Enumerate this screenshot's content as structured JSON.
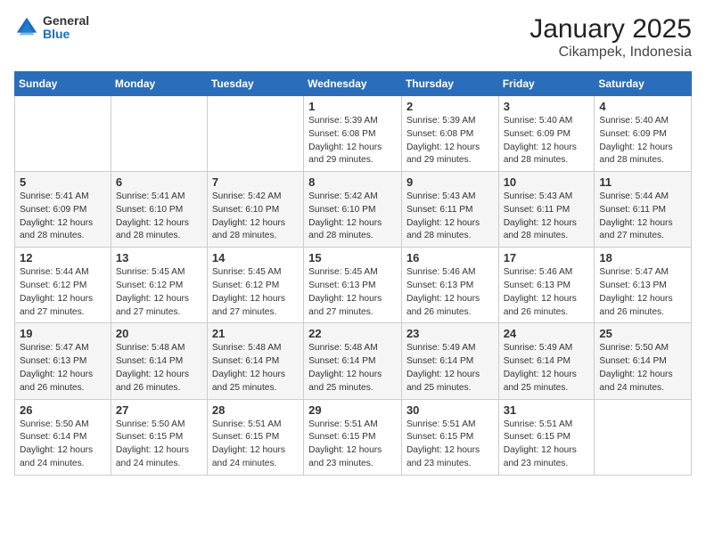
{
  "logo": {
    "line1": "General",
    "line2": "Blue"
  },
  "title": "January 2025",
  "subtitle": "Cikampek, Indonesia",
  "days_header": [
    "Sunday",
    "Monday",
    "Tuesday",
    "Wednesday",
    "Thursday",
    "Friday",
    "Saturday"
  ],
  "weeks": [
    [
      {
        "day": "",
        "sunrise": "",
        "sunset": "",
        "daylight": ""
      },
      {
        "day": "",
        "sunrise": "",
        "sunset": "",
        "daylight": ""
      },
      {
        "day": "",
        "sunrise": "",
        "sunset": "",
        "daylight": ""
      },
      {
        "day": "1",
        "sunrise": "Sunrise: 5:39 AM",
        "sunset": "Sunset: 6:08 PM",
        "daylight": "Daylight: 12 hours and 29 minutes."
      },
      {
        "day": "2",
        "sunrise": "Sunrise: 5:39 AM",
        "sunset": "Sunset: 6:08 PM",
        "daylight": "Daylight: 12 hours and 29 minutes."
      },
      {
        "day": "3",
        "sunrise": "Sunrise: 5:40 AM",
        "sunset": "Sunset: 6:09 PM",
        "daylight": "Daylight: 12 hours and 28 minutes."
      },
      {
        "day": "4",
        "sunrise": "Sunrise: 5:40 AM",
        "sunset": "Sunset: 6:09 PM",
        "daylight": "Daylight: 12 hours and 28 minutes."
      }
    ],
    [
      {
        "day": "5",
        "sunrise": "Sunrise: 5:41 AM",
        "sunset": "Sunset: 6:09 PM",
        "daylight": "Daylight: 12 hours and 28 minutes."
      },
      {
        "day": "6",
        "sunrise": "Sunrise: 5:41 AM",
        "sunset": "Sunset: 6:10 PM",
        "daylight": "Daylight: 12 hours and 28 minutes."
      },
      {
        "day": "7",
        "sunrise": "Sunrise: 5:42 AM",
        "sunset": "Sunset: 6:10 PM",
        "daylight": "Daylight: 12 hours and 28 minutes."
      },
      {
        "day": "8",
        "sunrise": "Sunrise: 5:42 AM",
        "sunset": "Sunset: 6:10 PM",
        "daylight": "Daylight: 12 hours and 28 minutes."
      },
      {
        "day": "9",
        "sunrise": "Sunrise: 5:43 AM",
        "sunset": "Sunset: 6:11 PM",
        "daylight": "Daylight: 12 hours and 28 minutes."
      },
      {
        "day": "10",
        "sunrise": "Sunrise: 5:43 AM",
        "sunset": "Sunset: 6:11 PM",
        "daylight": "Daylight: 12 hours and 28 minutes."
      },
      {
        "day": "11",
        "sunrise": "Sunrise: 5:44 AM",
        "sunset": "Sunset: 6:11 PM",
        "daylight": "Daylight: 12 hours and 27 minutes."
      }
    ],
    [
      {
        "day": "12",
        "sunrise": "Sunrise: 5:44 AM",
        "sunset": "Sunset: 6:12 PM",
        "daylight": "Daylight: 12 hours and 27 minutes."
      },
      {
        "day": "13",
        "sunrise": "Sunrise: 5:45 AM",
        "sunset": "Sunset: 6:12 PM",
        "daylight": "Daylight: 12 hours and 27 minutes."
      },
      {
        "day": "14",
        "sunrise": "Sunrise: 5:45 AM",
        "sunset": "Sunset: 6:12 PM",
        "daylight": "Daylight: 12 hours and 27 minutes."
      },
      {
        "day": "15",
        "sunrise": "Sunrise: 5:45 AM",
        "sunset": "Sunset: 6:13 PM",
        "daylight": "Daylight: 12 hours and 27 minutes."
      },
      {
        "day": "16",
        "sunrise": "Sunrise: 5:46 AM",
        "sunset": "Sunset: 6:13 PM",
        "daylight": "Daylight: 12 hours and 26 minutes."
      },
      {
        "day": "17",
        "sunrise": "Sunrise: 5:46 AM",
        "sunset": "Sunset: 6:13 PM",
        "daylight": "Daylight: 12 hours and 26 minutes."
      },
      {
        "day": "18",
        "sunrise": "Sunrise: 5:47 AM",
        "sunset": "Sunset: 6:13 PM",
        "daylight": "Daylight: 12 hours and 26 minutes."
      }
    ],
    [
      {
        "day": "19",
        "sunrise": "Sunrise: 5:47 AM",
        "sunset": "Sunset: 6:13 PM",
        "daylight": "Daylight: 12 hours and 26 minutes."
      },
      {
        "day": "20",
        "sunrise": "Sunrise: 5:48 AM",
        "sunset": "Sunset: 6:14 PM",
        "daylight": "Daylight: 12 hours and 26 minutes."
      },
      {
        "day": "21",
        "sunrise": "Sunrise: 5:48 AM",
        "sunset": "Sunset: 6:14 PM",
        "daylight": "Daylight: 12 hours and 25 minutes."
      },
      {
        "day": "22",
        "sunrise": "Sunrise: 5:48 AM",
        "sunset": "Sunset: 6:14 PM",
        "daylight": "Daylight: 12 hours and 25 minutes."
      },
      {
        "day": "23",
        "sunrise": "Sunrise: 5:49 AM",
        "sunset": "Sunset: 6:14 PM",
        "daylight": "Daylight: 12 hours and 25 minutes."
      },
      {
        "day": "24",
        "sunrise": "Sunrise: 5:49 AM",
        "sunset": "Sunset: 6:14 PM",
        "daylight": "Daylight: 12 hours and 25 minutes."
      },
      {
        "day": "25",
        "sunrise": "Sunrise: 5:50 AM",
        "sunset": "Sunset: 6:14 PM",
        "daylight": "Daylight: 12 hours and 24 minutes."
      }
    ],
    [
      {
        "day": "26",
        "sunrise": "Sunrise: 5:50 AM",
        "sunset": "Sunset: 6:14 PM",
        "daylight": "Daylight: 12 hours and 24 minutes."
      },
      {
        "day": "27",
        "sunrise": "Sunrise: 5:50 AM",
        "sunset": "Sunset: 6:15 PM",
        "daylight": "Daylight: 12 hours and 24 minutes."
      },
      {
        "day": "28",
        "sunrise": "Sunrise: 5:51 AM",
        "sunset": "Sunset: 6:15 PM",
        "daylight": "Daylight: 12 hours and 24 minutes."
      },
      {
        "day": "29",
        "sunrise": "Sunrise: 5:51 AM",
        "sunset": "Sunset: 6:15 PM",
        "daylight": "Daylight: 12 hours and 23 minutes."
      },
      {
        "day": "30",
        "sunrise": "Sunrise: 5:51 AM",
        "sunset": "Sunset: 6:15 PM",
        "daylight": "Daylight: 12 hours and 23 minutes."
      },
      {
        "day": "31",
        "sunrise": "Sunrise: 5:51 AM",
        "sunset": "Sunset: 6:15 PM",
        "daylight": "Daylight: 12 hours and 23 minutes."
      },
      {
        "day": "",
        "sunrise": "",
        "sunset": "",
        "daylight": ""
      }
    ]
  ]
}
